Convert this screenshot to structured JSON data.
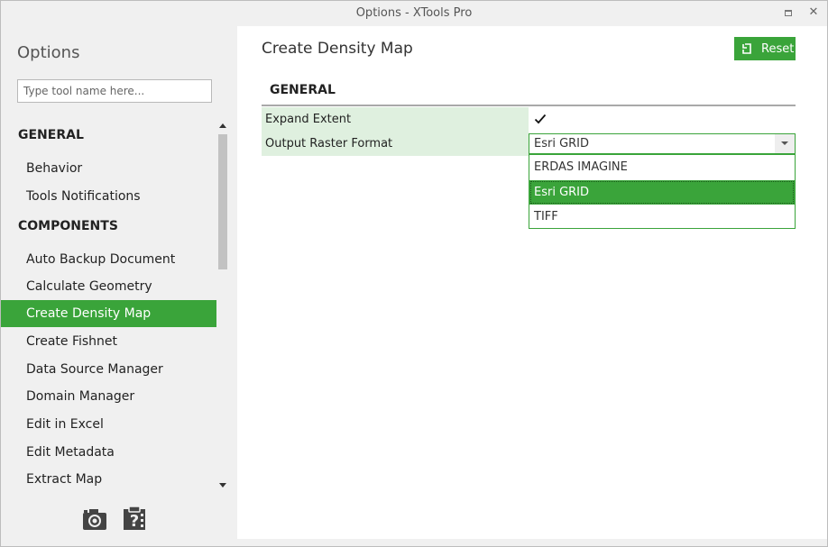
{
  "window": {
    "title": "Options - XTools Pro",
    "close_glyph": "✕"
  },
  "sidebar": {
    "title": "Options",
    "search_placeholder": "Type tool name here...",
    "sections": [
      {
        "header": "GENERAL",
        "items": [
          "Behavior",
          "Tools Notifications"
        ]
      },
      {
        "header": "COMPONENTS",
        "items": [
          "Auto Backup Document",
          "Calculate Geometry",
          "Create Density Map",
          "Create Fishnet",
          "Data Source Manager",
          "Domain Manager",
          "Edit in Excel",
          "Edit Metadata",
          "Extract Map"
        ]
      }
    ],
    "selected_item": "Create Density Map",
    "bottom_icons": [
      "camera-icon",
      "help-document-icon"
    ]
  },
  "main": {
    "page_title": "Create Density Map",
    "reset_label": "Reset",
    "section_title": "GENERAL",
    "properties": [
      {
        "label": "Expand Extent",
        "type": "checkbox",
        "checked": true
      },
      {
        "label": "Output Raster Format",
        "type": "select",
        "value": "Esri GRID"
      }
    ],
    "dropdown": {
      "open": true,
      "options": [
        "ERDAS IMAGINE",
        "Esri GRID",
        "TIFF"
      ],
      "selected": "Esri GRID"
    }
  },
  "colors": {
    "accent": "#3aa43a",
    "label_bg": "#dff0df",
    "sidebar_bg": "#f0f0f0"
  }
}
